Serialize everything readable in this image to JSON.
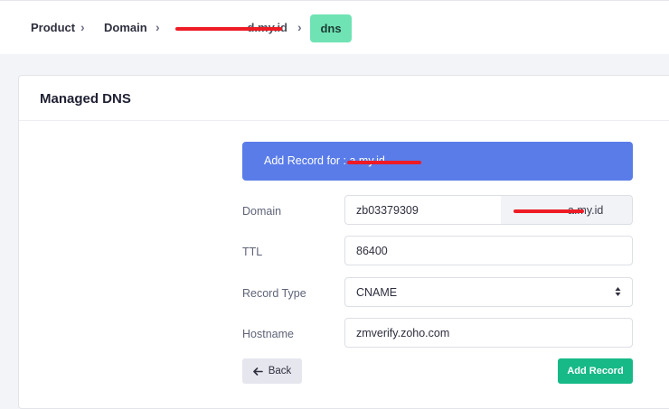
{
  "breadcrumb": {
    "items": [
      "Product",
      "Domain",
      "d.my.id",
      "dns"
    ],
    "separator": "›"
  },
  "card": {
    "title": "Managed DNS"
  },
  "form": {
    "banner_text": "Add Record for : a.my.id",
    "domain_label": "Domain",
    "domain_value": "zb03379309",
    "domain_suffix": "a.my.id",
    "ttl_label": "TTL",
    "ttl_value": "86400",
    "record_type_label": "Record Type",
    "record_type_value": "CNAME",
    "hostname_label": "Hostname",
    "hostname_value": "zmverify.zoho.com",
    "back_label": "Back",
    "add_label": "Add Record"
  },
  "colors": {
    "banner": "#5a7ce9",
    "active_crumb": "#6fe3b4",
    "add_button": "#17b987",
    "redaction": "#ee1c25"
  },
  "icons": {
    "separator": "chevron-right-icon",
    "select": "select-arrows-icon",
    "back": "arrow-left-icon"
  }
}
